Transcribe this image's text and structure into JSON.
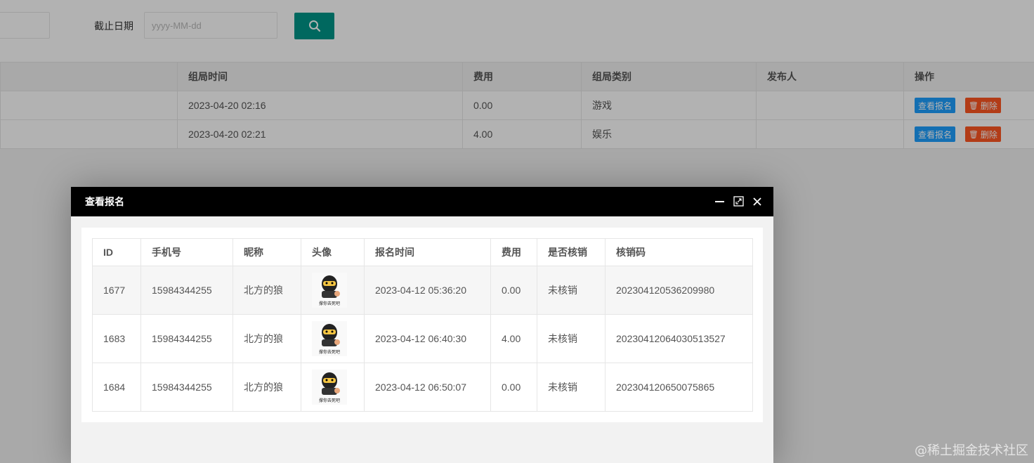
{
  "search": {
    "end_date_label": "截止日期",
    "end_date_placeholder": "yyyy-MM-dd",
    "search_icon": "search-icon",
    "button_color": "#009688"
  },
  "main_table": {
    "headers": [
      "组局时间",
      "费用",
      "组局类别",
      "发布人",
      "操作"
    ],
    "rows": [
      {
        "time": "2023-04-20 02:16",
        "fee": "0.00",
        "category": "游戏",
        "publisher": ""
      },
      {
        "time": "2023-04-20 02:21",
        "fee": "4.00",
        "category": "娱乐",
        "publisher": ""
      }
    ],
    "view_label": "查看报名",
    "delete_label": "删除",
    "delete_icon": "trash-icon",
    "view_color": "#1E9FFF",
    "delete_color": "#FF5722"
  },
  "dialog": {
    "title": "查看报名",
    "controls": [
      "minimize-icon",
      "maximize-icon",
      "close-icon"
    ],
    "table": {
      "headers": [
        "ID",
        "手机号",
        "昵称",
        "头像",
        "报名时间",
        "费用",
        "是否核销",
        "核销码"
      ],
      "rows": [
        {
          "id": "1677",
          "phone": "15984344255",
          "nickname": "北方的狼",
          "avatar_caption": "撑你去死吧",
          "time": "2023-04-12 05:36:20",
          "fee": "0.00",
          "status": "未核销",
          "code": "202304120536209980"
        },
        {
          "id": "1683",
          "phone": "15984344255",
          "nickname": "北方的狼",
          "avatar_caption": "撑你去死吧",
          "time": "2023-04-12 06:40:30",
          "fee": "4.00",
          "status": "未核销",
          "code": "20230412064030513527"
        },
        {
          "id": "1684",
          "phone": "15984344255",
          "nickname": "北方的狼",
          "avatar_caption": "撑你去死吧",
          "time": "2023-04-12 06:50:07",
          "fee": "0.00",
          "status": "未核销",
          "code": "202304120650075865"
        }
      ]
    }
  },
  "watermark": "@稀土掘金技术社区"
}
